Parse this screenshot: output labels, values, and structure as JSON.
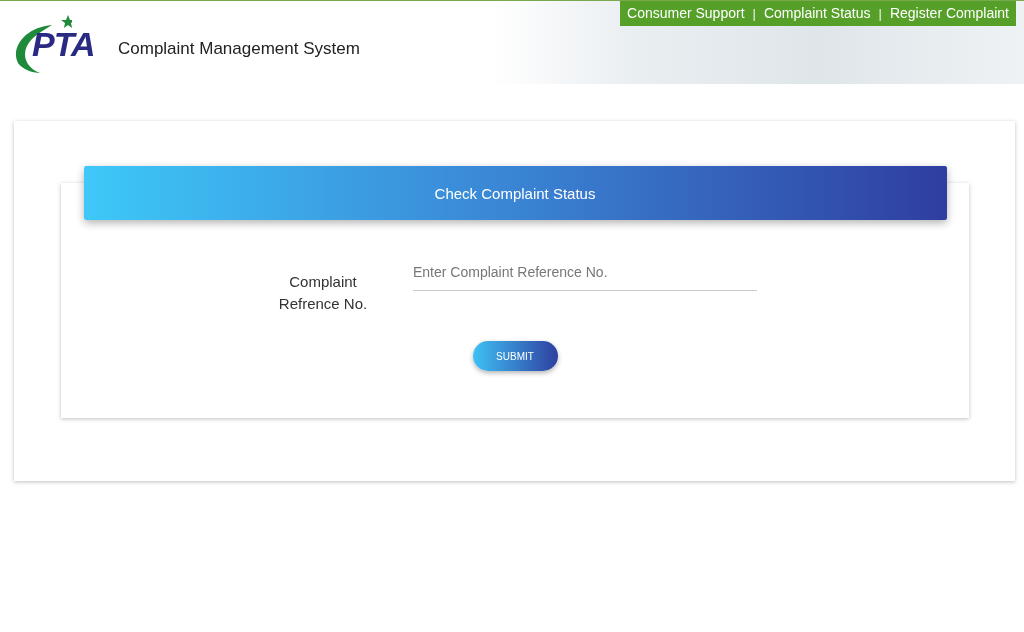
{
  "header": {
    "logo_text": "PTA",
    "title": "Complaint Management System",
    "nav": [
      {
        "kind": "link",
        "text": "Consumer Support"
      },
      {
        "kind": "separator",
        "text": "|"
      },
      {
        "kind": "link",
        "text": "Complaint Status"
      },
      {
        "kind": "separator",
        "text": "|"
      },
      {
        "kind": "link",
        "text": "Register Complaint"
      }
    ]
  },
  "form": {
    "heading": "Check Complaint Status",
    "field_label": "Complaint Refrence No.",
    "placeholder": "Enter Complaint Reference No.",
    "submit": "SUBMIT"
  }
}
